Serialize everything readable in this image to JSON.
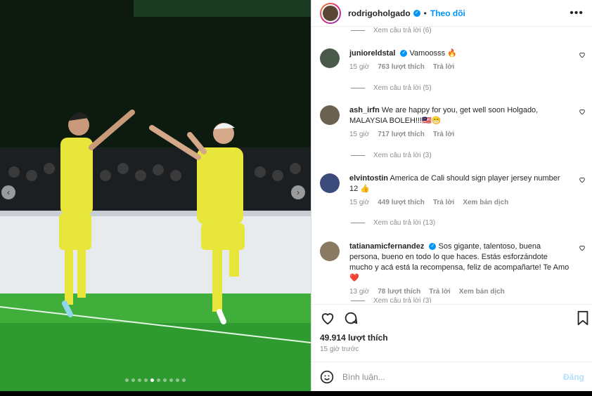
{
  "header": {
    "username": "rodrigoholgado",
    "separator": "•",
    "follow_label": "Theo dõi",
    "more_icon": "more-icon"
  },
  "partial_top_replies": "Xem câu trả lời (6)",
  "comments": [
    {
      "username": "junioreldstal",
      "verified": true,
      "text": "Vamoosss 🔥",
      "time": "15 giờ",
      "likes": "763 lượt thích",
      "reply": "Trả lời",
      "translate": "",
      "view_replies": "Xem câu trả lời (5)",
      "avatar_color": "#4a5a4a"
    },
    {
      "username": "ash_irfn",
      "verified": false,
      "text": "We are happy for you, get well soon Holgado, MALAYSIA BOLEH!!!🇲🇾😁",
      "time": "15 giờ",
      "likes": "717 lượt thích",
      "reply": "Trả lời",
      "translate": "",
      "view_replies": "Xem câu trả lời (3)",
      "avatar_color": "#6b6150"
    },
    {
      "username": "elvintostin",
      "verified": false,
      "text": "America de Cali should sign player jersey number 12 👍",
      "time": "15 giờ",
      "likes": "449 lượt thích",
      "reply": "Trả lời",
      "translate": "Xem bản dịch",
      "view_replies": "Xem câu trả lời (13)",
      "avatar_color": "#3a4a7a"
    },
    {
      "username": "tatianamicfernandez",
      "verified": true,
      "text": "Sos gigante, talentoso, buena persona, bueno en todo lo que haces. Estás esforzándote mucho y acá está la recompensa, feliz de acompañarte! Te Amo ❤️",
      "time": "13 giờ",
      "likes": "78 lượt thích",
      "reply": "Trả lời",
      "translate": "Xem bản dịch",
      "view_replies": "Xem câu trả lời (3)",
      "avatar_color": "#8a7a62"
    }
  ],
  "footer": {
    "likes": "49.914 lượt thích",
    "time": "15 giờ trước",
    "comment_placeholder": "Bình luận...",
    "post_label": "Đăng"
  },
  "carousel": {
    "total_dots": 10,
    "active_dot": 4
  },
  "colors": {
    "accent": "#0095f6",
    "jersey": "#e8e63a",
    "pitch": "#3fae3a"
  }
}
